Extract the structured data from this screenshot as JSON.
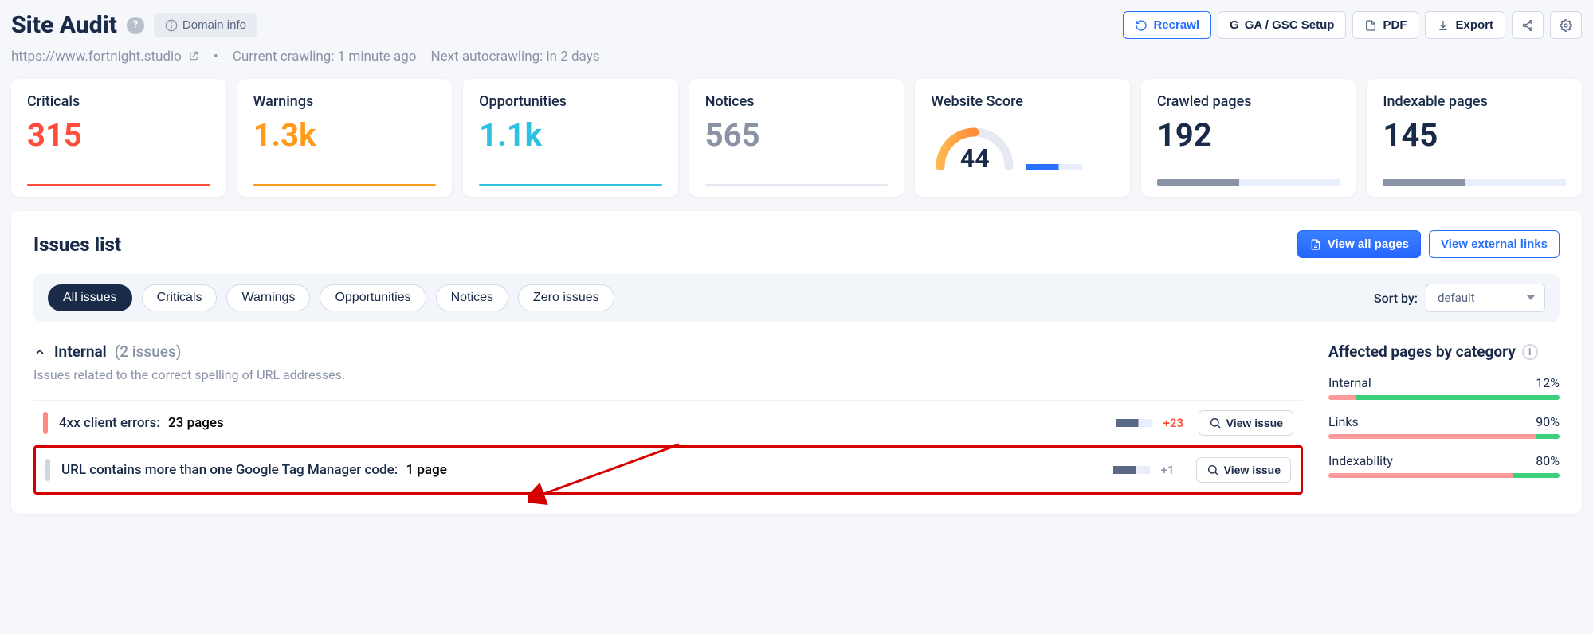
{
  "header": {
    "title": "Site Audit",
    "domain_info_label": "Domain info",
    "buttons": {
      "recrawl": "Recrawl",
      "ga_gsc": "GA / GSC Setup",
      "pdf": "PDF",
      "export": "Export"
    }
  },
  "subheader": {
    "url": "https://www.fortnight.studio",
    "crawling": "Current crawling: 1 minute ago",
    "autocrawl": "Next autocrawling: in 2 days"
  },
  "cards": {
    "criticals": {
      "label": "Criticals",
      "value": "315"
    },
    "warnings": {
      "label": "Warnings",
      "value": "1.3k"
    },
    "opportunities": {
      "label": "Opportunities",
      "value": "1.1k"
    },
    "notices": {
      "label": "Notices",
      "value": "565"
    },
    "score": {
      "label": "Website Score",
      "value": "44"
    },
    "crawled": {
      "label": "Crawled pages",
      "value": "192"
    },
    "indexable": {
      "label": "Indexable pages",
      "value": "145"
    }
  },
  "panel": {
    "title": "Issues list",
    "view_all_pages": "View all pages",
    "view_external": "View external links",
    "filters": {
      "all": "All issues",
      "criticals": "Criticals",
      "warnings": "Warnings",
      "opportunities": "Opportunities",
      "notices": "Notices",
      "zero": "Zero issues"
    },
    "sort_label": "Sort by:",
    "sort_value": "default",
    "section": {
      "name": "Internal",
      "count_label": "(2 issues)",
      "desc": "Issues related to the correct spelling of URL addresses."
    },
    "issues": [
      {
        "title": "4xx client errors:",
        "pages": "23 pages",
        "delta": "+23",
        "sev": "red"
      },
      {
        "title": "URL contains more than one Google Tag Manager code:",
        "pages": "1 page",
        "delta": "+1",
        "sev": "gray"
      }
    ],
    "view_issue_label": "View issue",
    "categories": {
      "header": "Affected pages by category",
      "items": [
        {
          "name": "Internal",
          "pct": "12%",
          "fill": 88
        },
        {
          "name": "Links",
          "pct": "90%",
          "fill": 10
        },
        {
          "name": "Indexability",
          "pct": "80%",
          "fill": 20
        }
      ]
    }
  }
}
